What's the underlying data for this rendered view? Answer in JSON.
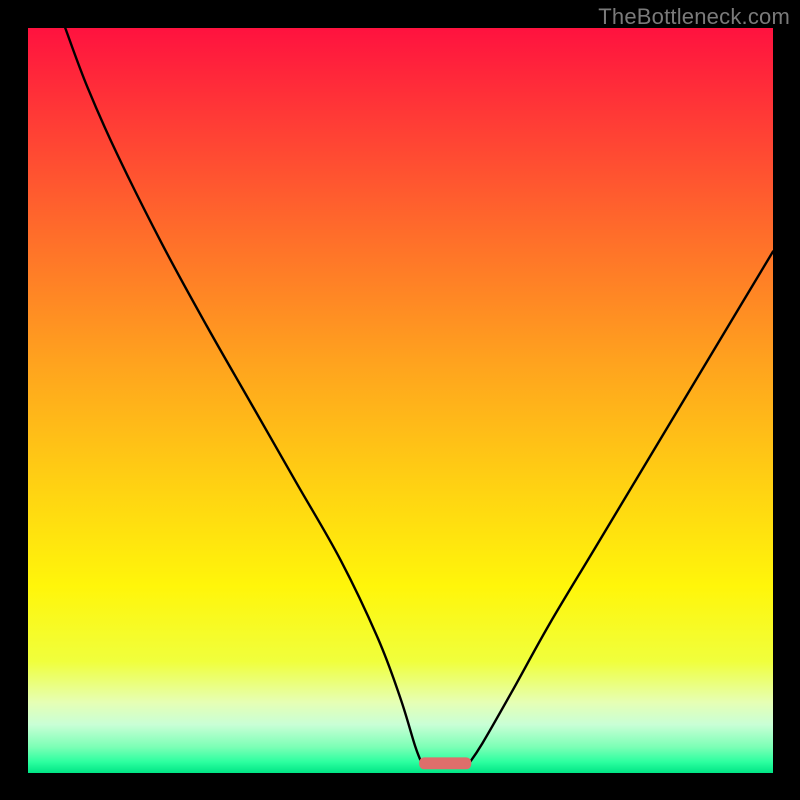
{
  "watermark": "TheBottleneck.com",
  "colors": {
    "bg": "#000000",
    "gradient_stops": [
      {
        "offset": 0.0,
        "color": "#ff123f"
      },
      {
        "offset": 0.12,
        "color": "#ff3a36"
      },
      {
        "offset": 0.28,
        "color": "#ff6e2a"
      },
      {
        "offset": 0.45,
        "color": "#ffa31e"
      },
      {
        "offset": 0.62,
        "color": "#ffd312"
      },
      {
        "offset": 0.75,
        "color": "#fff60a"
      },
      {
        "offset": 0.85,
        "color": "#f0ff3c"
      },
      {
        "offset": 0.905,
        "color": "#e6ffb4"
      },
      {
        "offset": 0.935,
        "color": "#c9ffd6"
      },
      {
        "offset": 0.965,
        "color": "#7cffb6"
      },
      {
        "offset": 0.985,
        "color": "#2dffa0"
      },
      {
        "offset": 1.0,
        "color": "#00e585"
      }
    ],
    "marker": "#de6e6b",
    "curve": "#000000"
  },
  "chart_data": {
    "type": "line",
    "title": "",
    "xlabel": "",
    "ylabel": "",
    "xlim": [
      0,
      100
    ],
    "ylim": [
      0,
      100
    ],
    "left_curve": [
      {
        "x": 5.0,
        "y": 100.0
      },
      {
        "x": 8.0,
        "y": 92.0
      },
      {
        "x": 12.0,
        "y": 83.0
      },
      {
        "x": 18.0,
        "y": 71.0
      },
      {
        "x": 24.0,
        "y": 60.0
      },
      {
        "x": 30.0,
        "y": 49.5
      },
      {
        "x": 36.0,
        "y": 39.0
      },
      {
        "x": 42.0,
        "y": 28.5
      },
      {
        "x": 47.0,
        "y": 18.0
      },
      {
        "x": 50.0,
        "y": 10.0
      },
      {
        "x": 52.0,
        "y": 3.5
      },
      {
        "x": 53.0,
        "y": 1.0
      }
    ],
    "right_curve": [
      {
        "x": 59.0,
        "y": 1.0
      },
      {
        "x": 61.0,
        "y": 4.0
      },
      {
        "x": 65.0,
        "y": 11.0
      },
      {
        "x": 70.0,
        "y": 20.0
      },
      {
        "x": 76.0,
        "y": 30.0
      },
      {
        "x": 82.0,
        "y": 40.0
      },
      {
        "x": 88.0,
        "y": 50.0
      },
      {
        "x": 94.0,
        "y": 60.0
      },
      {
        "x": 100.0,
        "y": 70.0
      }
    ],
    "trough_marker": {
      "x_start": 52.5,
      "x_end": 59.5,
      "y": 0.5,
      "height": 1.6
    },
    "annotations": []
  }
}
